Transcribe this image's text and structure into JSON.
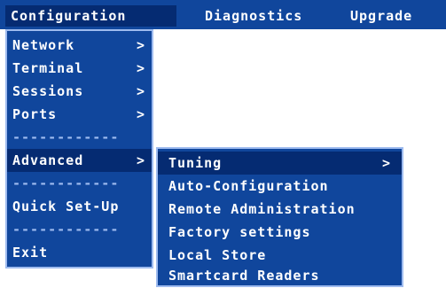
{
  "colors": {
    "menu_bg": "#10469c",
    "highlight_bg": "#052b72",
    "border": "#9ebbef",
    "text": "#ffffff"
  },
  "menubar": {
    "items": [
      {
        "label": "Configuration"
      },
      {
        "label": "Diagnostics"
      },
      {
        "label": "Upgrade"
      }
    ]
  },
  "config_menu": {
    "items": [
      {
        "label": "Network",
        "chevron": ">"
      },
      {
        "label": "Terminal",
        "chevron": ">"
      },
      {
        "label": "Sessions",
        "chevron": ">"
      },
      {
        "label": "Ports",
        "chevron": ">"
      },
      {
        "separator": "------------"
      },
      {
        "label": "Advanced",
        "chevron": ">"
      },
      {
        "separator": "------------"
      },
      {
        "label": "Quick Set-Up"
      },
      {
        "separator": "------------"
      },
      {
        "label": "Exit"
      }
    ]
  },
  "advanced_menu": {
    "items": [
      {
        "label": "Tuning",
        "chevron": ">"
      },
      {
        "label": "Auto-Configuration"
      },
      {
        "label": "Remote Administration"
      },
      {
        "label": "Factory settings"
      },
      {
        "label": "Local Store"
      },
      {
        "label": "Smartcard Readers"
      }
    ]
  }
}
